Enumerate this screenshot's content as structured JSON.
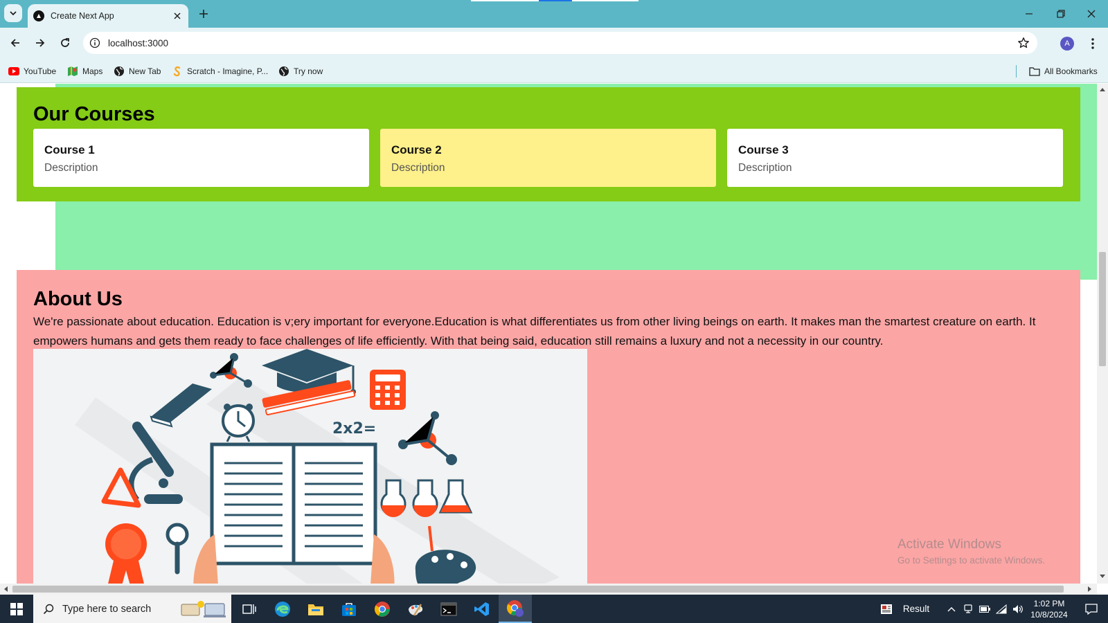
{
  "browser": {
    "tab_title": "Create Next App",
    "url": "localhost:3000",
    "profile_initial": "A",
    "bookmarks": [
      {
        "label": "YouTube",
        "icon": "youtube-icon"
      },
      {
        "label": "Maps",
        "icon": "maps-icon"
      },
      {
        "label": "New Tab",
        "icon": "globe-icon"
      },
      {
        "label": "Scratch - Imagine, P...",
        "icon": "scratch-icon"
      },
      {
        "label": "Try now",
        "icon": "globe-icon"
      }
    ],
    "all_bookmarks_label": "All Bookmarks"
  },
  "page": {
    "courses": {
      "heading": "Our Courses",
      "items": [
        {
          "title": "Course 1",
          "description": "Description"
        },
        {
          "title": "Course 2",
          "description": "Description"
        },
        {
          "title": "Course 3",
          "description": "Description"
        }
      ]
    },
    "about": {
      "heading": "About Us",
      "text": "We're passionate about education. Education is v;ery important for everyone.Education is what differentiates us from other living beings on earth. It makes man the smartest creature on earth. It empowers humans and gets them ready to face challenges of life efficiently. With that being said, education still remains a luxury and not a necessity in our country.",
      "illustration_text": "2x2="
    }
  },
  "watermark": {
    "line1": "Activate Windows",
    "line2": "Go to Settings to activate Windows."
  },
  "taskbar": {
    "search_placeholder": "Type here to search",
    "tray_result": "Result",
    "time": "1:02 PM",
    "date": "10/8/2024"
  },
  "colors": {
    "chrome_frame": "#5bb7c6",
    "courses_bg": "#84cc16",
    "highlight_card": "#fef08a",
    "green_band": "#89efaa",
    "about_bg": "#fca5a5"
  }
}
